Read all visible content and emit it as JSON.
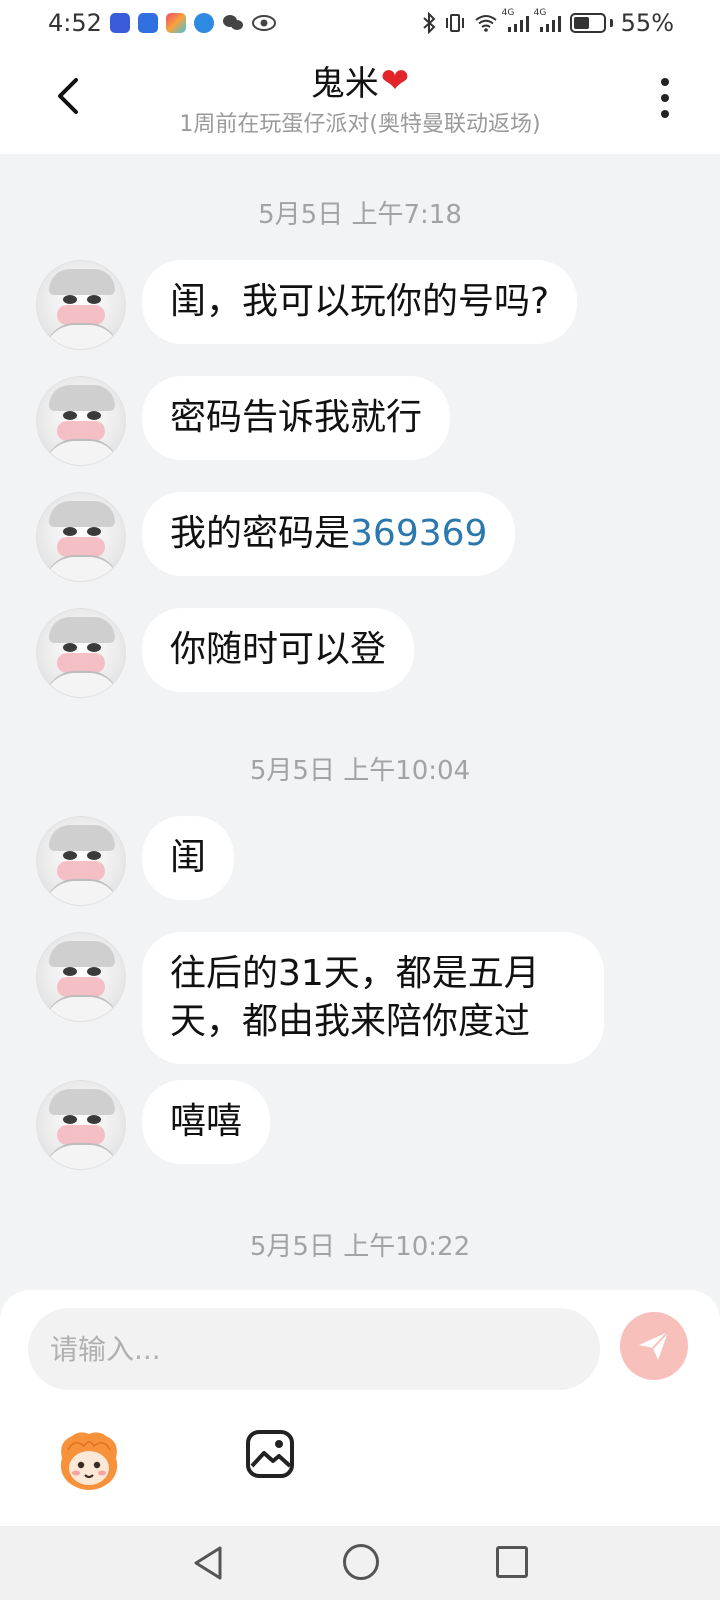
{
  "status_bar": {
    "time": "4:52",
    "network_labels": [
      "4G",
      "4G"
    ],
    "battery_percent": "55%",
    "battery_level": 0.55
  },
  "header": {
    "title": "鬼米",
    "title_emoji": "❤",
    "subtitle": "1周前在玩蛋仔派对(奥特曼联动返场)"
  },
  "messages": {
    "timestamps": [
      "5月5日 上午7:18",
      "5月5日 上午10:04",
      "5月5日 上午10:22"
    ],
    "bubbles": [
      {
        "text": "闺，我可以玩你的号吗?"
      },
      {
        "text": "密码告诉我就行"
      },
      {
        "text_prefix": "我的密码是",
        "link": "369369"
      },
      {
        "text": "你随时可以登"
      },
      {
        "text": "闺"
      },
      {
        "text": "往后的31天，都是五月天，都由我来陪你度过"
      },
      {
        "text": "嘻嘻"
      }
    ]
  },
  "input": {
    "placeholder": "请输入..."
  },
  "colors": {
    "background": "#f2f3f5",
    "bubble": "#ffffff",
    "link": "#2a78ad",
    "send_button": "#f8c0bb",
    "heart": "#e2242b"
  },
  "icons": {
    "back": "chevron-left-icon",
    "more": "more-vertical-icon",
    "send": "paper-plane-icon",
    "emoji": "emoji-mascot-icon",
    "image": "image-icon"
  }
}
